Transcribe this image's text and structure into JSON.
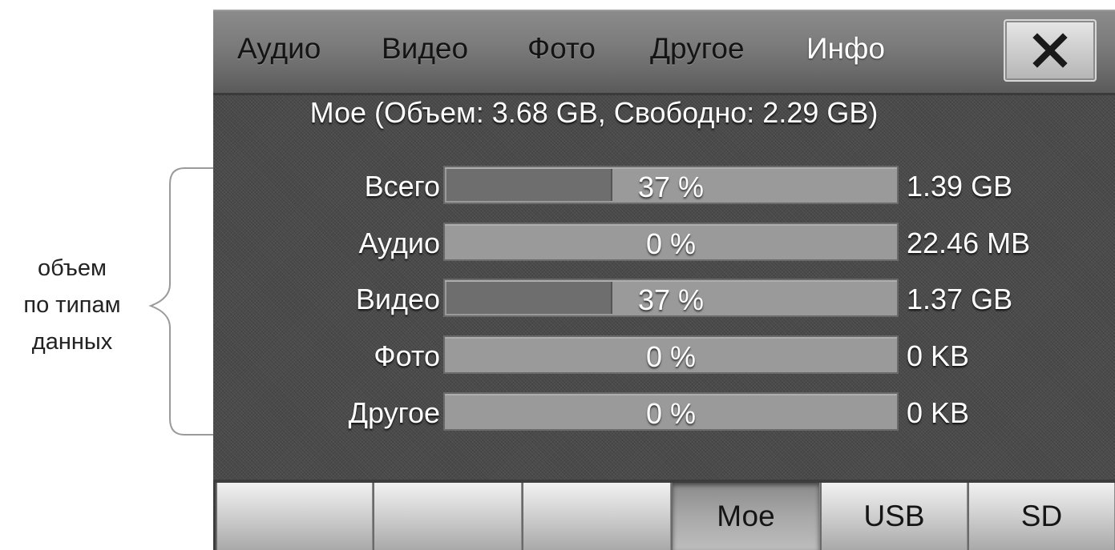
{
  "annotation": {
    "lines": [
      "объем",
      "по типам",
      "данных"
    ]
  },
  "topbar": {
    "tabs": [
      {
        "label": "Аудио",
        "active": false
      },
      {
        "label": "Видео",
        "active": false
      },
      {
        "label": "Фото",
        "active": false
      },
      {
        "label": "Другое",
        "active": false
      },
      {
        "label": "Инфо",
        "active": true
      }
    ],
    "close_icon": "close-icon"
  },
  "storage": {
    "title": "Мое (Объем: 3.68 GB, Свободно: 2.29 GB)",
    "rows": [
      {
        "label": "Всего",
        "percent_text": "37 %",
        "fill_fraction": 0.37,
        "size": "1.39 GB"
      },
      {
        "label": "Аудио",
        "percent_text": "0 %",
        "fill_fraction": 0,
        "size": "22.46 MB"
      },
      {
        "label": "Видео",
        "percent_text": "37 %",
        "fill_fraction": 0.37,
        "size": "1.37 GB"
      },
      {
        "label": "Фото",
        "percent_text": "0 %",
        "fill_fraction": 0,
        "size": "0 KB"
      },
      {
        "label": "Другое",
        "percent_text": "0 %",
        "fill_fraction": 0,
        "size": "0 KB"
      }
    ]
  },
  "bottombar": {
    "tabs": [
      {
        "label": "",
        "active": false
      },
      {
        "label": "",
        "active": false
      },
      {
        "label": "",
        "active": false
      },
      {
        "label": "Мое",
        "active": true
      },
      {
        "label": "USB",
        "active": false
      },
      {
        "label": "SD",
        "active": false
      }
    ]
  },
  "colors": {
    "panel_bg": "#4a4a4a",
    "bar_track": "#9a9a9a",
    "bar_fill": "#6e6e6e",
    "active_tab_text": "#ffffff"
  }
}
